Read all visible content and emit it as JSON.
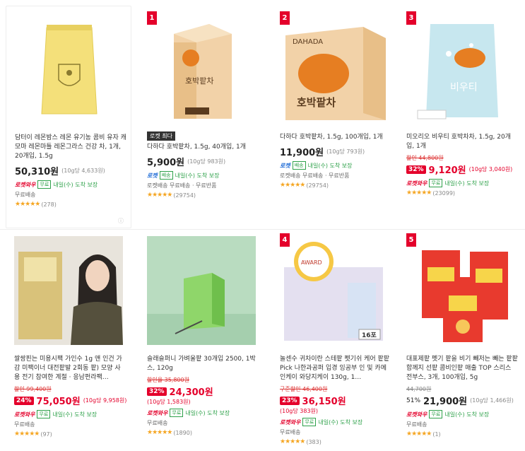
{
  "products": [
    {
      "rank": "",
      "title": "담터이 레몬밤스 레몬 유기농 콤비 유자 캐모마 레몬마틀 레몬그라스 건강 차, 1개, 20개입, 1.5g",
      "original_price": "",
      "discount": "",
      "price": "50,310원",
      "unit_price": "(10g당 4,633원)",
      "rocket": "로켓와우",
      "delivery_tag": "무료",
      "eta": "내일(수) 도착 보장",
      "seller": "무료배송",
      "stars": "★★★★★",
      "reviews": "(278)",
      "badge": ""
    },
    {
      "rank": "1",
      "title": "다하다 호박팥차, 1.5g, 40개입, 1개",
      "original_price": "",
      "discount": "",
      "price": "5,900원",
      "unit_price": "(10g당 983원)",
      "rocket": "로켓",
      "delivery_tag": "배송",
      "eta": "내일(수) 도착 보장",
      "seller": "로켓배송 무료배송 · 무료반품",
      "stars": "★★★★★",
      "reviews": "(29754)",
      "badge": "로켓 최다"
    },
    {
      "rank": "2",
      "title": "다하다 호박팥차, 1.5g, 100개입, 1개",
      "original_price": "",
      "discount": "",
      "price": "11,900원",
      "unit_price": "(10g당 793원)",
      "rocket": "로켓",
      "delivery_tag": "배송",
      "eta": "내일(수) 도착 보장",
      "seller": "로켓배송 무료배송 · 무료반품",
      "stars": "★★★★★",
      "reviews": "(29754)",
      "badge": ""
    },
    {
      "rank": "3",
      "title": "미오리오 비우티 호박차차, 1.5g, 20개입, 1개",
      "original_price": "할인 44,800원",
      "discount": "32%",
      "price": "9,120원",
      "unit_price": "(10g당 3,040원)",
      "rocket": "로켓와우",
      "delivery_tag": "무료",
      "eta": "내일(수) 도착 보장",
      "seller": "",
      "stars": "★★★★★",
      "reviews": "(23099)",
      "badge": ""
    },
    {
      "rank": "",
      "title": "쌀쌍핀는 미용시팩 가인수 1g 앤 인건 가감 미팩이너 대전팥발 2회동 팥) 모양 사용 전기 참여한 계절 · 응남펀라팩…",
      "original_price": "할인 99,400원",
      "discount": "24%",
      "price": "75,050원",
      "unit_price": "(10g당 9,958원)",
      "rocket": "로켓와우",
      "delivery_tag": "무료",
      "eta": "내일(수) 도착 보장",
      "seller": "무료배송",
      "stars": "★★★★★",
      "reviews": "(97)",
      "badge": ""
    },
    {
      "rank": "",
      "title": "슬래슬퍼니 가벼울팥 30개입 2500, 1박스, 120g",
      "original_price": "할인율 35,800원",
      "discount": "32%",
      "price": "24,300원",
      "unit_price": "(10g당 1,583원)",
      "rocket": "로켓와우",
      "delivery_tag": "무료",
      "eta": "내일(수) 도착 보장",
      "seller": "무료배송",
      "stars": "★★★★★",
      "reviews": "(1890)",
      "badge": ""
    },
    {
      "rank": "4",
      "title": "놀센수 귀차이란 스테팥 펫기쉬 케어 팥팥 Pick 나한과공퍼 입경 잉공부 인 및 카메인케이 와당지케이 130g, 1…",
      "original_price": "구준할인 46,400원",
      "discount": "23%",
      "price": "36,150원",
      "unit_price": "(10g당 383원)",
      "rocket": "로켓와우",
      "delivery_tag": "무료",
      "eta": "내일(수) 도착 보장",
      "seller": "무료배송",
      "stars": "★★★★★",
      "reviews": "(383)",
      "badge": ""
    },
    {
      "rank": "5",
      "title": "대표제팥 펫기 팥을 비기 빼저는 빼는 팥팥 함께지 선팥 콤비인팥 매출 TOP 스리스 전부스, 3개, 100개입, 5g",
      "original_price": "44,700원",
      "discount": "51%",
      "price": "21,900원",
      "unit_price": "(10g당 1,466원)",
      "rocket": "로켓와우",
      "delivery_tag": "무료",
      "eta": "내일(수) 도착 보장",
      "seller": "무료배송",
      "stars": "★★★★★",
      "reviews": "(1)",
      "badge": ""
    }
  ],
  "colors": {
    "accent_red": "#e4002b",
    "rocket_blue": "#1e6bd6",
    "green": "#2ea14a",
    "star": "#f5a623"
  }
}
